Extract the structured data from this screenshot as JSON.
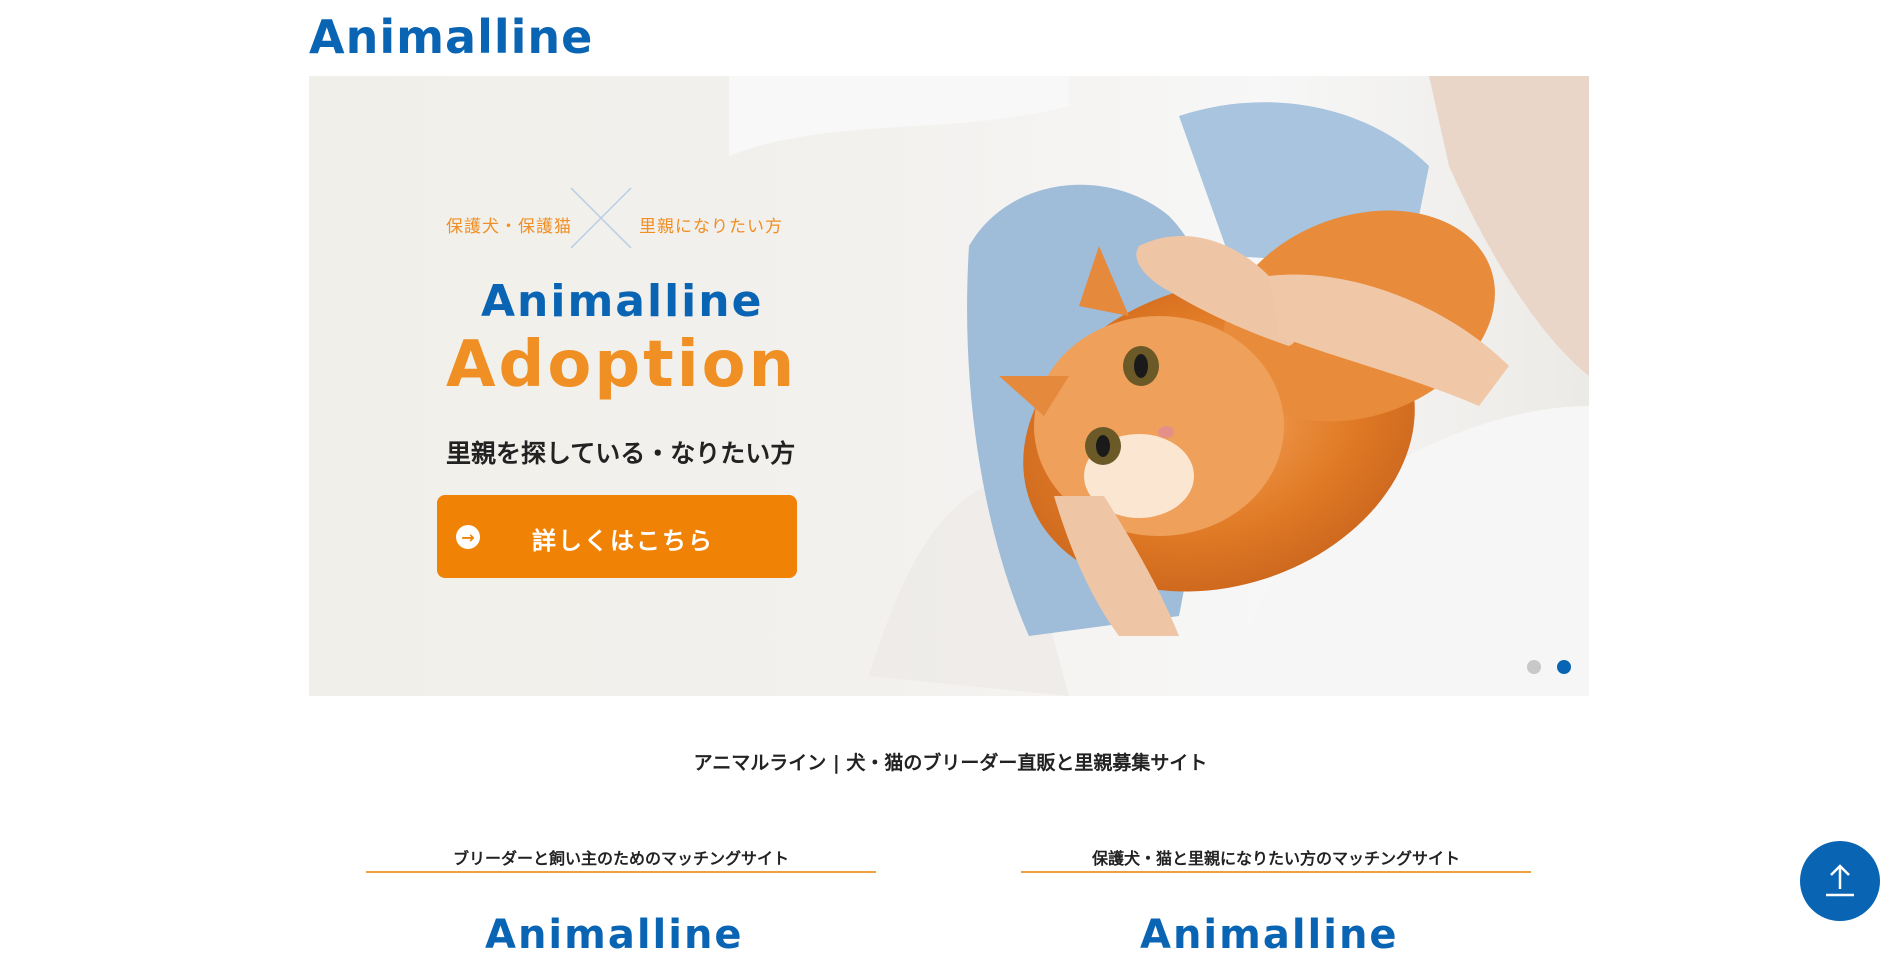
{
  "header": {
    "logo": "Animalline"
  },
  "hero": {
    "tag_left": "保護犬・保護猫",
    "tag_right": "里親になりたい方",
    "brand_top": "Animalline",
    "brand_bottom": "Adoption",
    "subtitle": "里親を探している・なりたい方",
    "cta_label": "詳しくはこちら",
    "cta_icon": "arrow-right-circle-icon",
    "slides": 2,
    "active_slide": 2
  },
  "tagline": "アニマルライン | 犬・猫のブリーダー直販と里親募集サイト",
  "columns": [
    {
      "heading": "ブリーダーと飼い主のためのマッチングサイト",
      "logo": "Animalline"
    },
    {
      "heading": "保護犬・猫と里親になりたい方のマッチングサイト",
      "logo": "Animalline"
    }
  ],
  "back_to_top": {
    "icon": "arrow-up-icon"
  },
  "colors": {
    "brand_blue": "#0a64b4",
    "brand_orange": "#f08205"
  }
}
